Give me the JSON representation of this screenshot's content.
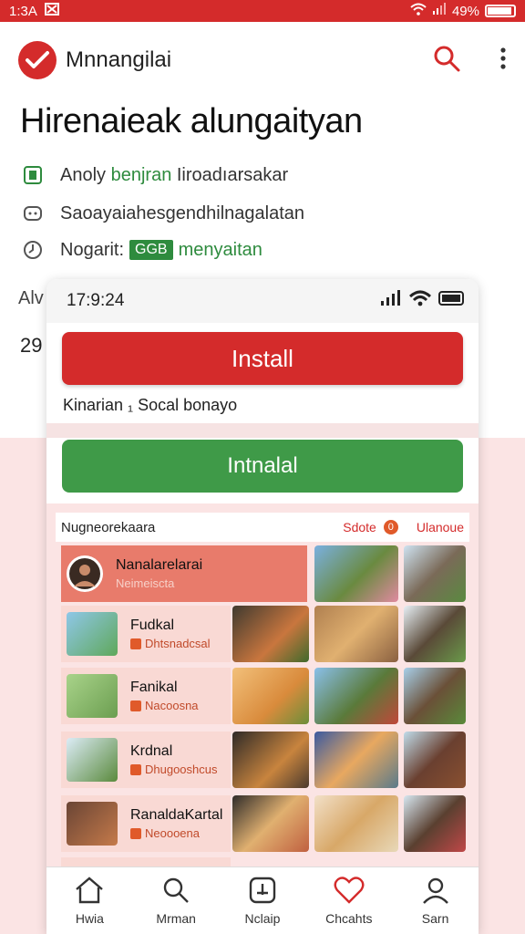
{
  "status": {
    "time": "1:3A",
    "battery": "49%"
  },
  "app": {
    "name": "Mnnangilai"
  },
  "hero": {
    "title": "Hirenaieak alungaityan"
  },
  "info": [
    {
      "prefix": "Anoly",
      "highlight": "benjran",
      "suffix": "Iiroadıarsakar",
      "icon": "app-icon"
    },
    {
      "text": "Saoayaiahesgendhilnagalatan",
      "icon": "device-icon"
    },
    {
      "prefix": "Nogarit:",
      "tag": "GGB",
      "highlight": "menyaitan",
      "icon": "clock-icon"
    }
  ],
  "background_text": {
    "line1": "Alv",
    "line2": "29"
  },
  "phone": {
    "time": "17:9:24",
    "install_label": "Install",
    "subtitle": "Kinarian ₁ Socal bonayo",
    "second_button": "Intnalal",
    "list_title": "Nugneorekaara",
    "list_action": "Sdote",
    "list_badge": "0",
    "list_action2": "Ulanoue",
    "rows": [
      {
        "title": "Nanalarelarai",
        "subtitle": "Neimeiscta"
      },
      {
        "title": "Fudkal",
        "subtitle": "Dhtsnadcsal"
      },
      {
        "title": "Fanikal",
        "subtitle": "Nacoosna"
      },
      {
        "title": "Krdnal",
        "subtitle": "Dhugooshcus"
      },
      {
        "title": "RanaldaKartal",
        "subtitle": "Neoooena"
      }
    ]
  },
  "nav": [
    {
      "label": "Hwia",
      "icon": "home-icon"
    },
    {
      "label": "Mrman",
      "icon": "search-icon"
    },
    {
      "label": "Nclaip",
      "icon": "add-icon"
    },
    {
      "label": "Chcahts",
      "icon": "heart-icon"
    },
    {
      "label": "Sarn",
      "icon": "profile-icon"
    }
  ],
  "colors": {
    "brand": "#d42b2b",
    "green": "#2e8b3e",
    "pink": "#fbe4e4"
  }
}
